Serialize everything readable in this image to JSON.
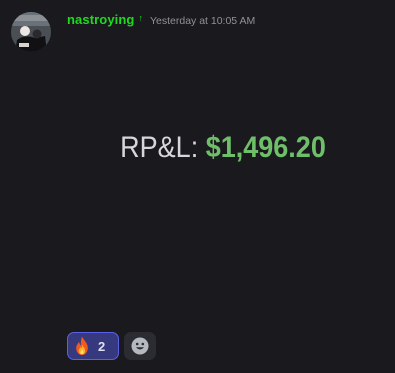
{
  "message": {
    "author": "nastroying",
    "author_badge": "↑",
    "timestamp": "Yesterday at 10:05 AM",
    "author_color": "#1ddb1d"
  },
  "pnl": {
    "label": "RP&L:",
    "value": "$1,496.20",
    "value_color": "#6fbf6a"
  },
  "reactions": [
    {
      "emoji_icon": "fire-icon",
      "count": "2",
      "active": true
    }
  ],
  "add_reaction": {
    "icon": "smile-icon"
  },
  "colors": {
    "background": "#1a1a1e",
    "reaction_active_bg": "#37397f",
    "reaction_active_border": "#5b61e6"
  }
}
